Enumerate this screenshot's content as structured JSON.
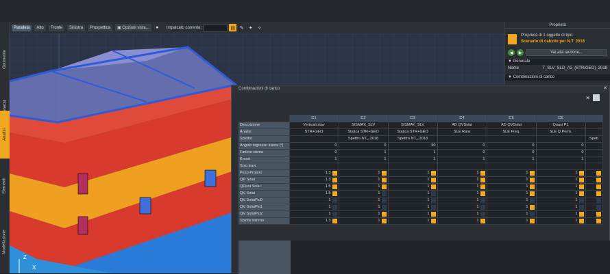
{
  "viewbar": {
    "buttons": [
      "Parallela",
      "Alto",
      "Fronte",
      "Sinistra",
      "Prospettica"
    ],
    "opzioni": "Opzioni vista...",
    "impalcato_label": "Impalcato corrente:"
  },
  "side_tabs": [
    "Geometrie",
    "Generali",
    "Analisi",
    "Elementi",
    "Modellazione"
  ],
  "axes": {
    "z": "Z",
    "x": "X"
  },
  "properties": {
    "title": "Proprietà",
    "summary_pre": "Proprietà di",
    "summary_count": "1",
    "summary_post": "oggetto di tipo:",
    "type": "Scenario di calcolo per N.T. 2018",
    "goto": "Vai alla sezione...",
    "section_general": "Generale",
    "name_label": "Nome",
    "name_value": "T_SLV_SLD_A2_(STR/GEO)_2018",
    "section_combos": "Combinazioni di carico"
  },
  "dialog": {
    "title": "Combinazioni di carico",
    "columns": [
      "C1",
      "C2",
      "C3",
      "C4",
      "C5",
      "C6",
      ""
    ],
    "rows": [
      {
        "label": "Descrizione",
        "cells": [
          "Verticali stav",
          "SISMAX_SLV",
          "SISMAY_SLV",
          "AD QVSolai",
          "AD QVSolai",
          "Quasi P1",
          ""
        ]
      },
      {
        "label": "Analisi",
        "cells": [
          "STR+GEO",
          "Statica STR+GEO",
          "Statica STR+GEO",
          "SLE Rara",
          "SLE Freq.",
          "SLE Q.Perm.",
          ""
        ]
      },
      {
        "label": "Spettro",
        "cells": [
          "",
          "Spettro NT_.2018",
          "Spettro NT_.2018",
          "",
          "",
          "",
          "Spett"
        ]
      },
      {
        "label": "Angolo ingresso sisma [°]",
        "cells": [
          "0",
          "0",
          "90",
          "0",
          "0",
          "0",
          ""
        ]
      },
      {
        "label": "Fattore sisma",
        "cells": [
          "0",
          "1",
          "1",
          "0",
          "0",
          "0",
          ""
        ]
      },
      {
        "label": "Kmod",
        "cells": [
          "1",
          "1",
          "1",
          "1",
          "1",
          "1",
          ""
        ]
      },
      {
        "label": "Solo travi",
        "cells": [
          "",
          "",
          "",
          "",
          "",
          "",
          ""
        ]
      }
    ],
    "factor_rows": [
      {
        "label": "Peso Proprio",
        "vals": [
          "1.3",
          "1",
          "1",
          "1",
          "1",
          "1"
        ],
        "checks": [
          1,
          1,
          1,
          1,
          1,
          1
        ]
      },
      {
        "label": "QP Solai",
        "vals": [
          "1.3",
          "1",
          "1",
          "1",
          "1",
          "1"
        ],
        "checks": [
          1,
          1,
          1,
          1,
          1,
          1
        ]
      },
      {
        "label": "QFissi Solai",
        "vals": [
          "1.5",
          "1",
          "1",
          "1",
          "1",
          "1"
        ],
        "checks": [
          1,
          1,
          1,
          1,
          1,
          1
        ]
      },
      {
        "label": "QV Solai",
        "vals": [
          "1.5",
          "1",
          "1",
          "1",
          "1",
          "1"
        ],
        "checks": [
          1,
          0,
          0,
          1,
          1,
          1
        ]
      },
      {
        "label": "QV SolaiPsi0",
        "vals": [
          "1",
          "1",
          "1",
          "1",
          "1",
          "1"
        ],
        "checks": [
          0,
          0,
          0,
          0,
          0,
          0
        ]
      },
      {
        "label": "QV SolaiPsi1",
        "vals": [
          "1",
          "1",
          "1",
          "1",
          "1",
          "1"
        ],
        "checks": [
          0,
          0,
          0,
          0,
          1,
          0
        ]
      },
      {
        "label": "QV SolaiPsi2",
        "vals": [
          "1",
          "1",
          "1",
          "1",
          "1",
          "1"
        ],
        "checks": [
          0,
          1,
          1,
          0,
          0,
          1
        ]
      },
      {
        "label": "Spinta terreno",
        "vals": [
          "1.3",
          "1",
          "1",
          "1",
          "1",
          "1"
        ],
        "checks": [
          1,
          1,
          1,
          1,
          1,
          1
        ]
      }
    ]
  },
  "colors": {
    "accent": "#f0a820",
    "red": "#e03a2e",
    "orange": "#f0a020",
    "blue": "#2f6fd6"
  }
}
